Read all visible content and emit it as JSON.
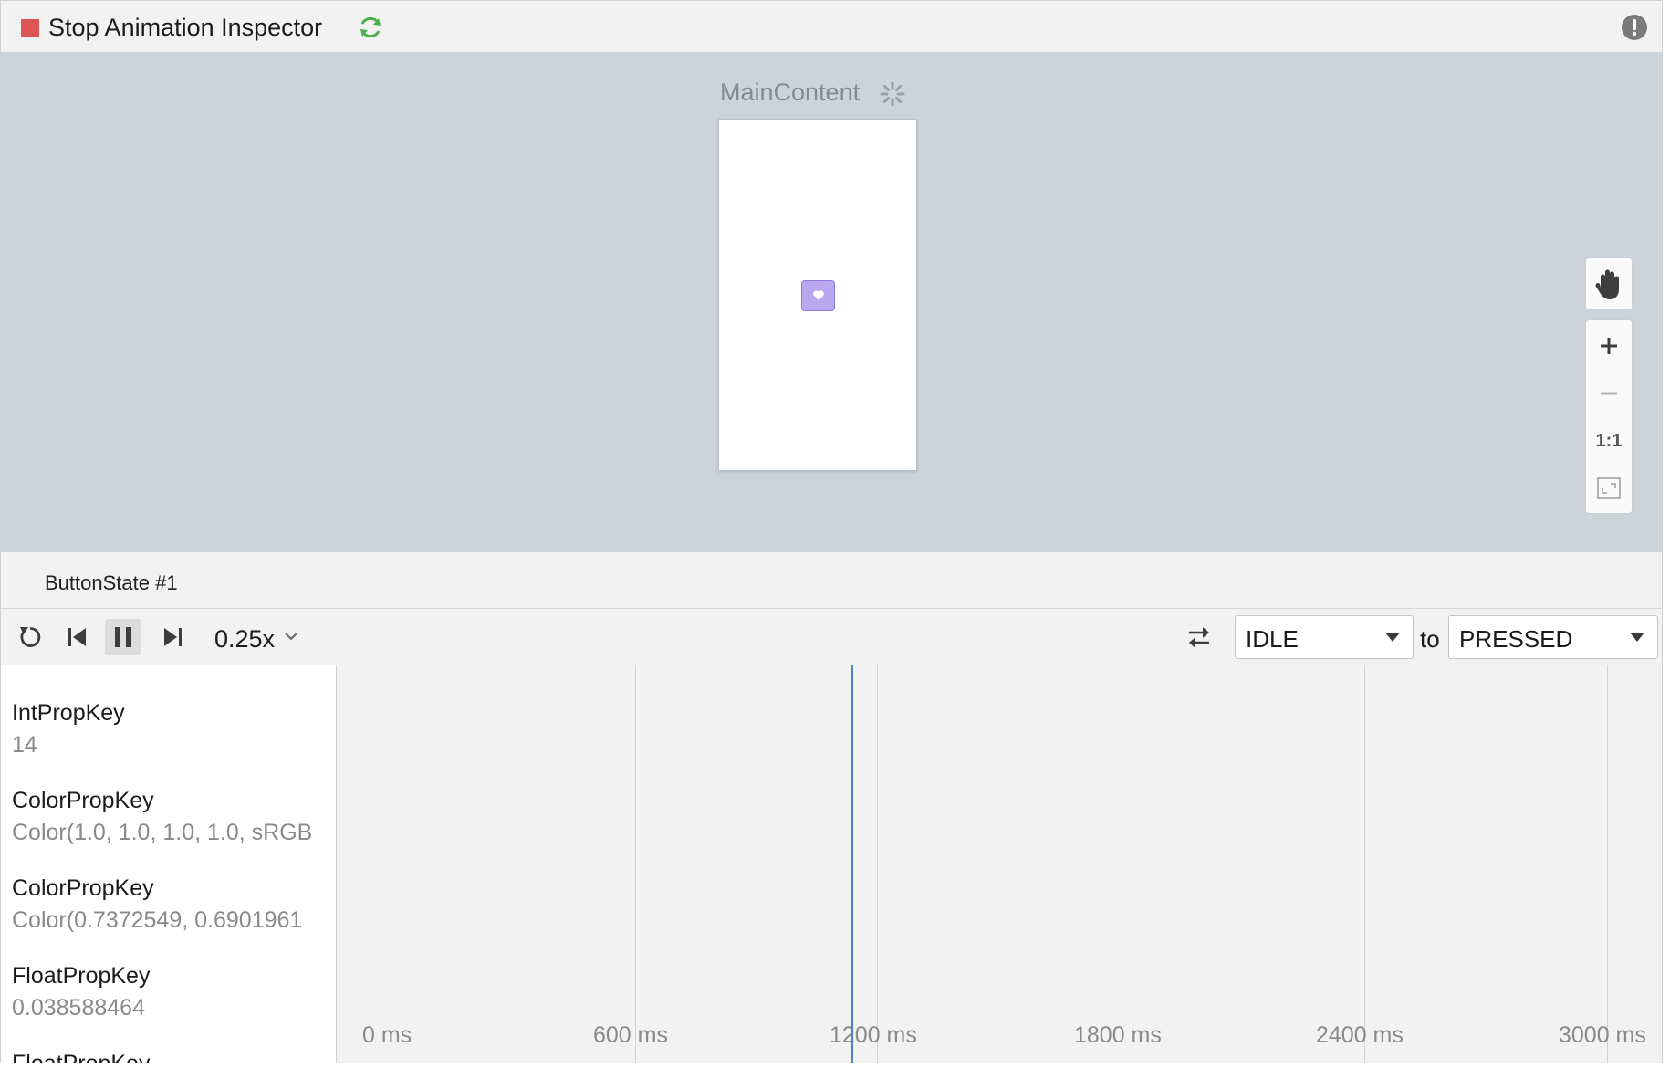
{
  "toolbar": {
    "title": "Stop Animation Inspector",
    "accent_stop": "#e05555",
    "accent_refresh": "#4caf50"
  },
  "preview": {
    "title": "MainContent"
  },
  "zoom": {
    "one_to_one": "1:1"
  },
  "tab": {
    "label": "ButtonState #1"
  },
  "controls": {
    "speed": "0.25x",
    "from_state": "IDLE",
    "to_label": "to",
    "to_state": "PRESSED"
  },
  "properties": [
    {
      "name": "IntPropKey",
      "value": "14"
    },
    {
      "name": "ColorPropKey",
      "value": "Color(1.0, 1.0, 1.0, 1.0, sRGB"
    },
    {
      "name": "ColorPropKey",
      "value": "Color(0.7372549, 0.6901961"
    },
    {
      "name": "FloatPropKey",
      "value": "0.038588464"
    },
    {
      "name": "FloatPropKey",
      "value": ""
    }
  ],
  "timeline": {
    "ticks": [
      "0 ms",
      "600 ms",
      "1200 ms",
      "1800 ms",
      "2400 ms",
      "3000 ms"
    ],
    "playhead_ms": 1130,
    "playhead_color": "#4a7fd4"
  }
}
